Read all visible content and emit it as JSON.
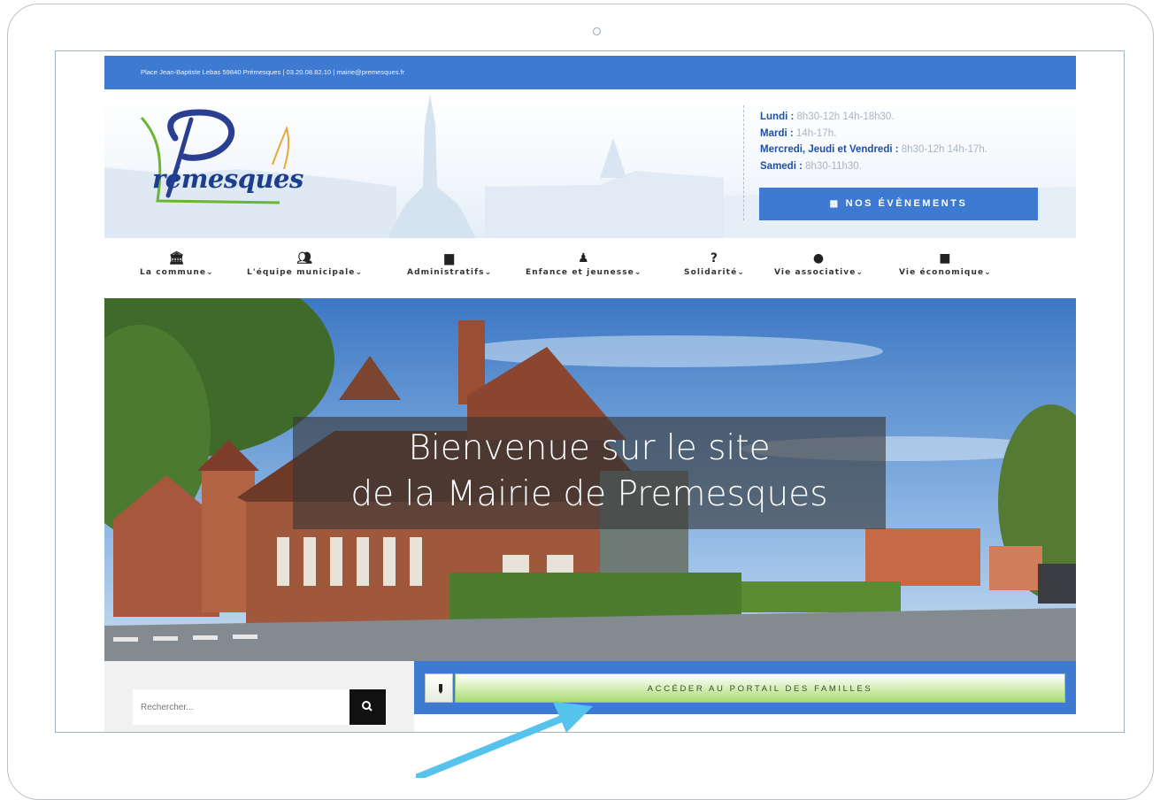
{
  "topbar": {
    "text": "Place Jean-Baptiste Lebas 59840 Prémesques  |  03.20.08.82.10  |  mairie@premesques.fr"
  },
  "logo": {
    "text": "rémesques"
  },
  "hours": [
    {
      "day": "Lundi :",
      "time": " 8h30-12h 14h-18h30."
    },
    {
      "day": "Mardi :",
      "time": " 14h-17h."
    },
    {
      "day": "Mercredi, Jeudi et Vendredi :",
      "time": " 8h30-12h 14h-17h."
    },
    {
      "day": "Samedi :",
      "time": " 8h30-11h30."
    }
  ],
  "events_button": {
    "label": "NOS ÉVÈNEMENTS",
    "icon": "calendar-icon"
  },
  "nav": [
    {
      "label": "La commune",
      "icon": "city-hall-icon"
    },
    {
      "label": "L'équipe municipale",
      "icon": "users-icon"
    },
    {
      "label": "Administratifs",
      "icon": "document-icon"
    },
    {
      "label": "Enfance et jeunesse",
      "icon": "child-icon"
    },
    {
      "label": "Solidarité",
      "icon": "help-icon"
    },
    {
      "label": "Vie associative",
      "icon": "globe-icon"
    },
    {
      "label": "Vie économique",
      "icon": "briefcase-icon"
    }
  ],
  "hero": {
    "line1": "Bienvenue sur le site",
    "line2": "de la Mairie de Premesques"
  },
  "search": {
    "placeholder": "Rechercher..."
  },
  "portal": {
    "label": "ACCÉDER AU PORTAIL DES FAMILLES"
  },
  "colors": {
    "accent": "#3e7ad2",
    "pointer_arrow": "#55c3ec",
    "portal_green": "#a7db71"
  }
}
